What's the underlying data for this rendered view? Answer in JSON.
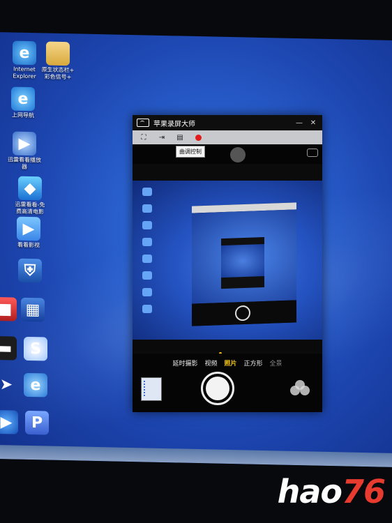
{
  "desktop": {
    "icons": [
      {
        "label": "Internet\nExplorer",
        "icon": "internet-explorer-icon"
      },
      {
        "label": "原生状态栏+\n彩色信号+",
        "icon": "folder-icon"
      },
      {
        "label": "上网导航",
        "icon": "web-nav-icon"
      },
      {
        "label": "迅雷看看播放\n器",
        "icon": "player-icon"
      },
      {
        "label": "迅雷看看-免\n费高清电影",
        "icon": "thunder-movie-icon"
      },
      {
        "label": "看看影视",
        "icon": "video-app-icon"
      },
      {
        "label": "",
        "icon": "shield-icon"
      },
      {
        "label": "",
        "icon": "red-app-icon"
      },
      {
        "label": "",
        "icon": "film-icon"
      },
      {
        "label": "",
        "icon": "dark-app-icon"
      },
      {
        "label": "",
        "icon": "s-app-icon"
      },
      {
        "label": "",
        "icon": "bird-icon"
      },
      {
        "label": "",
        "icon": "globe-app-icon"
      },
      {
        "label": "",
        "icon": "p-app-icon"
      },
      {
        "label": "",
        "icon": "blue-app-icon"
      }
    ]
  },
  "window": {
    "title": "苹果录屏大师",
    "controls": {
      "minimize": "—",
      "close": "✕"
    },
    "toolbar": {
      "buttons": [
        "fullscreen-icon",
        "cast-icon",
        "tuning-icon",
        "record-icon"
      ],
      "tooltip": "曲调控制"
    },
    "camera": {
      "modes": [
        "延时摄影",
        "视频",
        "照片",
        "正方形",
        "全景"
      ],
      "active_mode": "照片"
    }
  },
  "watermark": {
    "text": "hao",
    "number": "76"
  },
  "colors": {
    "accent_yellow": "#f5c518",
    "record_red": "#e21b1b",
    "desktop_blue": "#2a61cf"
  }
}
